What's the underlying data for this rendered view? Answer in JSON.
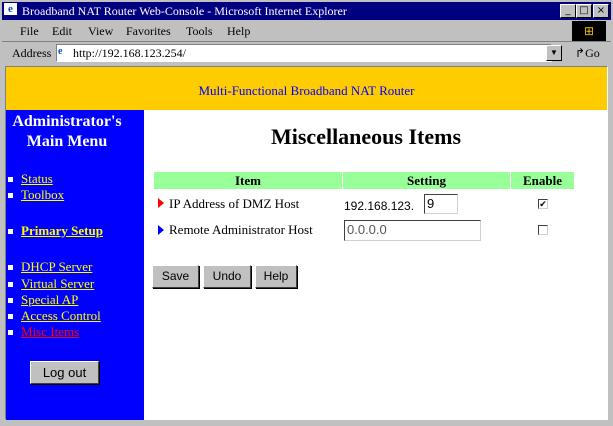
{
  "window": {
    "title": "Broadband NAT Router Web-Console - Microsoft Internet Explorer"
  },
  "menu": [
    "File",
    "Edit",
    "View",
    "Favorites",
    "Tools",
    "Help"
  ],
  "address": {
    "label": "Address",
    "url": "http://192.168.123.254/",
    "go": "Go"
  },
  "banner": "Multi-Functional Broadband NAT Router",
  "sidebar": {
    "title_line1": "Administrator's",
    "title_line2": "Main Menu",
    "items": [
      {
        "label": "Status"
      },
      {
        "label": "Toolbox"
      },
      {
        "label": "Primary Setup"
      },
      {
        "label": "DHCP Server"
      },
      {
        "label": "Virtual Server"
      },
      {
        "label": "Special AP"
      },
      {
        "label": "Access Control"
      },
      {
        "label": "Misc Items"
      }
    ],
    "logout": "Log out"
  },
  "main": {
    "title": "Miscellaneous Items",
    "headers": [
      "Item",
      "Setting",
      "Enable"
    ],
    "rows": [
      {
        "item": "IP Address of DMZ Host",
        "prefix": "192.168.123.",
        "value": "9",
        "enabled": true
      },
      {
        "item": "Remote Administrator Host",
        "value": "0.0.0.0",
        "enabled": false
      }
    ],
    "buttons": {
      "save": "Save",
      "undo": "Undo",
      "help": "Help"
    }
  },
  "colors": {
    "banner": "#ffcc00",
    "sidebar": "#0000ff",
    "header": "#99ff99",
    "active": "#ff0000",
    "link": "#ffff00"
  }
}
